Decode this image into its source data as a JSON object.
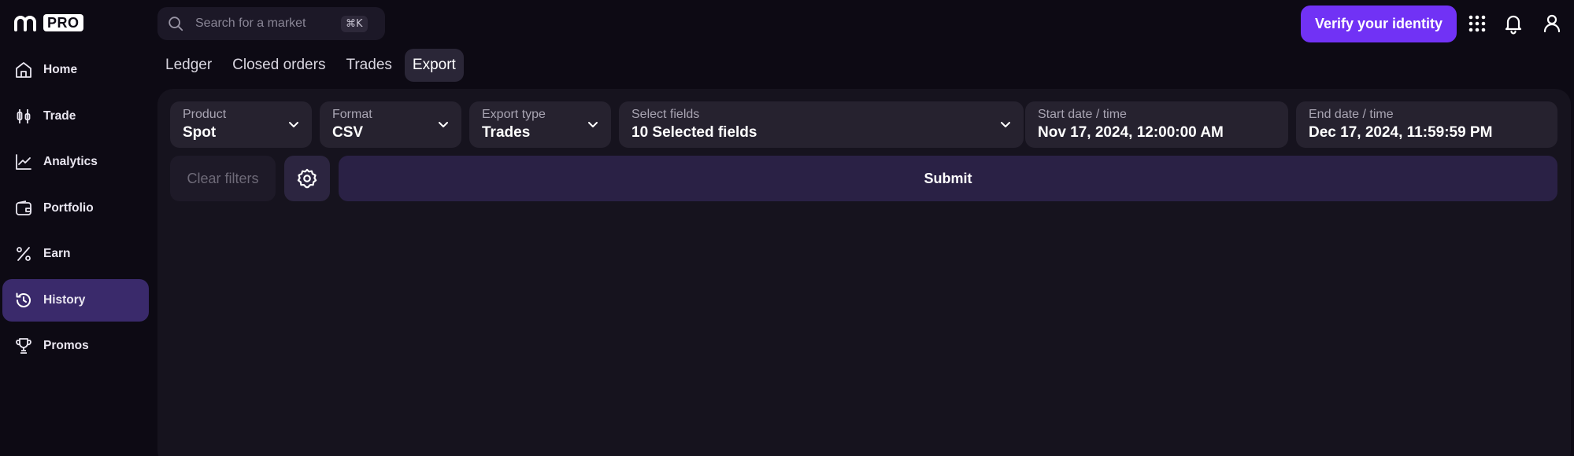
{
  "brand": {
    "logo_text": "m",
    "badge": "PRO"
  },
  "sidebar": {
    "items": [
      {
        "label": "Home",
        "icon": "home-icon",
        "active": false
      },
      {
        "label": "Trade",
        "icon": "candlestick-icon",
        "active": false
      },
      {
        "label": "Analytics",
        "icon": "chart-line-icon",
        "active": false
      },
      {
        "label": "Portfolio",
        "icon": "wallet-icon",
        "active": false
      },
      {
        "label": "Earn",
        "icon": "percent-icon",
        "active": false
      },
      {
        "label": "History",
        "icon": "history-icon",
        "active": true
      },
      {
        "label": "Promos",
        "icon": "trophy-icon",
        "active": false
      }
    ]
  },
  "header": {
    "search": {
      "placeholder": "Search for a market",
      "shortcut": "⌘K"
    },
    "verify_label": "Verify your identity",
    "icons": [
      "apps-grid-icon",
      "bell-icon",
      "user-icon"
    ]
  },
  "tabs": [
    {
      "label": "Ledger",
      "active": false
    },
    {
      "label": "Closed orders",
      "active": false
    },
    {
      "label": "Trades",
      "active": false
    },
    {
      "label": "Export",
      "active": true
    }
  ],
  "export_form": {
    "product": {
      "label": "Product",
      "value": "Spot"
    },
    "format": {
      "label": "Format",
      "value": "CSV"
    },
    "export_type": {
      "label": "Export type",
      "value": "Trades"
    },
    "fields": {
      "label": "Select fields",
      "value": "10 Selected fields"
    },
    "start": {
      "label": "Start date / time",
      "value": "Nov 17, 2024, 12:00:00 AM"
    },
    "end": {
      "label": "End date / time",
      "value": "Dec 17, 2024, 11:59:59 PM"
    },
    "clear_label": "Clear filters",
    "submit_label": "Submit"
  },
  "colors": {
    "accent": "#7132f5",
    "background": "#0d0a14",
    "panel": "#16131e",
    "active_nav": "#3a2a6b"
  }
}
